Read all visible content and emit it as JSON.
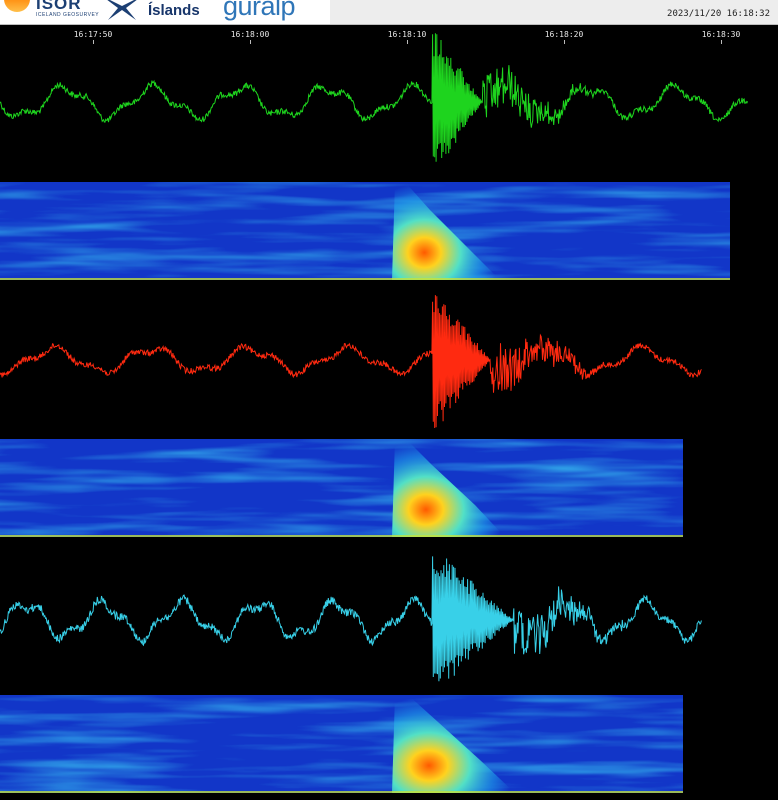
{
  "header": {
    "logos": [
      {
        "name": "ISOR",
        "subtitle": "ICELAND GEOSURVEY"
      },
      {
        "name": "Íslands"
      },
      {
        "name": "guralp"
      }
    ],
    "timestamp": "2023/11/20 16:18:32"
  },
  "time_axis": {
    "ticks": [
      "16:17:50",
      "16:18:00",
      "16:18:10",
      "16:18:20",
      "16:18:30"
    ]
  },
  "colors": {
    "background": "#000000",
    "channel_1": "#1ed41e",
    "channel_2": "#ff2a10",
    "channel_3": "#38d0e8",
    "spectrogram_low": "#1236c8",
    "spectrogram_high": "#ff5a00"
  },
  "channels": [
    {
      "color_key": "channel_1",
      "event_start": 0.556,
      "event_end": 0.62
    },
    {
      "color_key": "channel_2",
      "event_start": 0.556,
      "event_end": 0.63
    },
    {
      "color_key": "channel_3",
      "event_start": 0.556,
      "event_end": 0.66
    }
  ]
}
